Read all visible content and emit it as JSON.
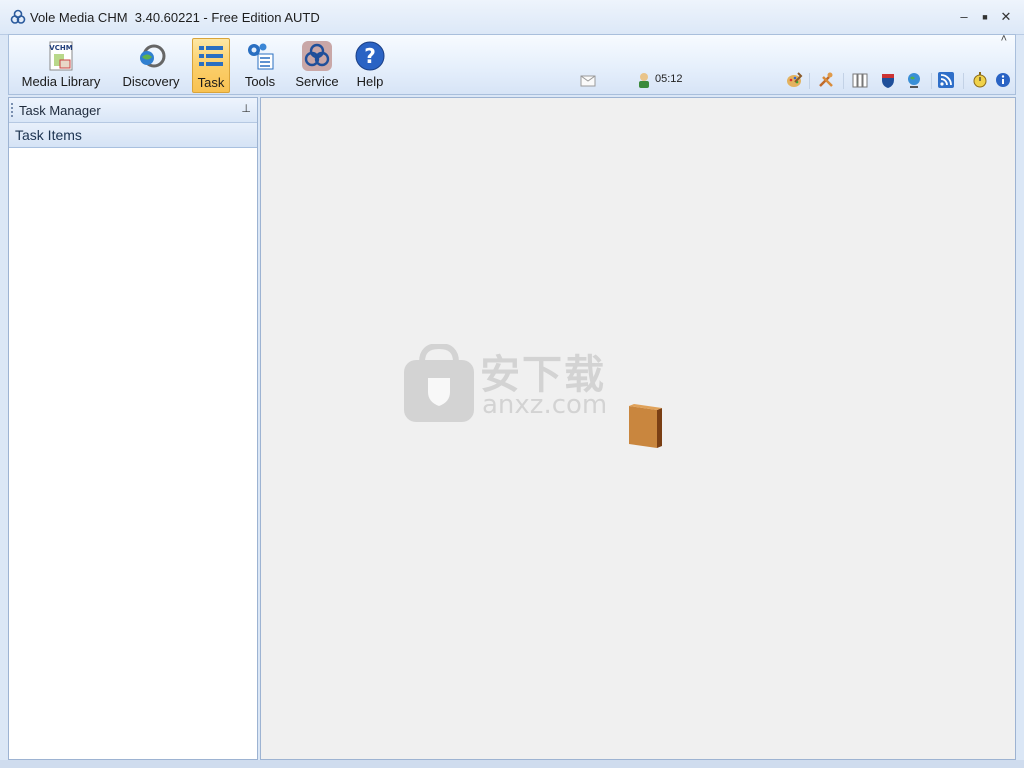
{
  "window": {
    "title": "Vole Media CHM  3.40.60221 - Free Edition AUTD",
    "minimize_glyph": "–",
    "maximize_glyph": "■",
    "close_glyph": "✕",
    "collapse_glyph": "˄"
  },
  "ribbon": {
    "buttons": [
      {
        "label": "Media Library",
        "icon": "vchm-book-icon",
        "active": false
      },
      {
        "label": "Discovery",
        "icon": "discovery-globe-icon",
        "active": false
      },
      {
        "label": "Task",
        "icon": "task-list-icon",
        "active": true
      },
      {
        "label": "Tools",
        "icon": "gears-checklist-icon",
        "active": false
      },
      {
        "label": "Service",
        "icon": "service-logo-icon",
        "active": false
      },
      {
        "label": "Help",
        "icon": "help-question-icon",
        "active": false
      }
    ]
  },
  "status": {
    "clock": "05:12",
    "icons": [
      "envelope-icon",
      "user-clock-icon",
      "palette-icon",
      "tools-icon",
      "books-icon",
      "highway-icon",
      "globe-icon",
      "rss-icon",
      "stopwatch-icon",
      "info-icon"
    ]
  },
  "task_manager": {
    "title": "Task Manager",
    "pin_glyph": "⊥",
    "section": "Task Items"
  },
  "watermark": {
    "cn": "安下载",
    "en": "anxz.com"
  },
  "colors": {
    "active_button": "#fbcf6a",
    "ribbon_bg": "#e4eefb",
    "content_bg": "#f0f0f0"
  }
}
